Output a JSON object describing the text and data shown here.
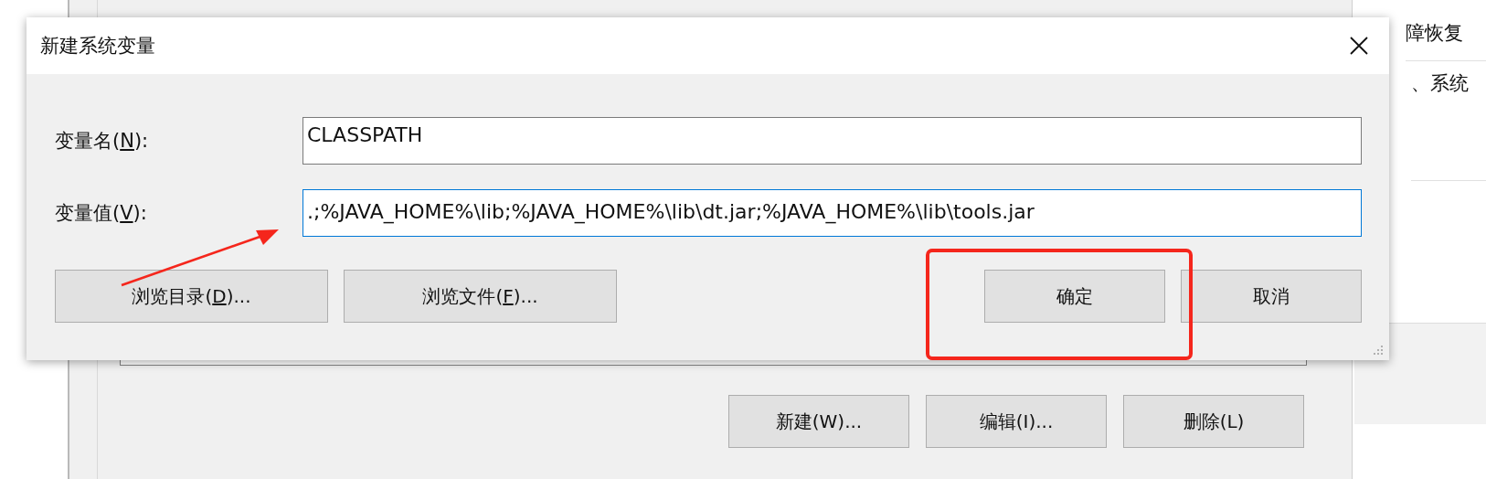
{
  "background_window": {
    "buttons": [
      {
        "label": "新建(W)..."
      },
      {
        "label": "编辑(I)..."
      },
      {
        "label": "删除(L)"
      }
    ]
  },
  "side_panel": {
    "lines": [
      "障恢复",
      "、系统"
    ]
  },
  "dialog": {
    "title": "新建系统变量",
    "fields": [
      {
        "before": "变量名(",
        "key": "N",
        "after": "):",
        "value": "CLASSPATH",
        "focused": false
      },
      {
        "before": "变量值(",
        "key": "V",
        "after": "):",
        "value": ".;%JAVA_HOME%\\lib;%JAVA_HOME%\\lib\\dt.jar;%JAVA_HOME%\\lib\\tools.jar",
        "focused": true
      }
    ],
    "browse_buttons": [
      {
        "before": "浏览目录(",
        "key": "D",
        "after": ")..."
      },
      {
        "before": "浏览文件(",
        "key": "F",
        "after": ")..."
      }
    ],
    "action_buttons": [
      {
        "label": "确定"
      },
      {
        "label": "取消"
      }
    ]
  },
  "annotations": [
    {
      "kind": "arrow",
      "color": "#f5261c"
    },
    {
      "kind": "box",
      "color": "#f5261c"
    }
  ]
}
